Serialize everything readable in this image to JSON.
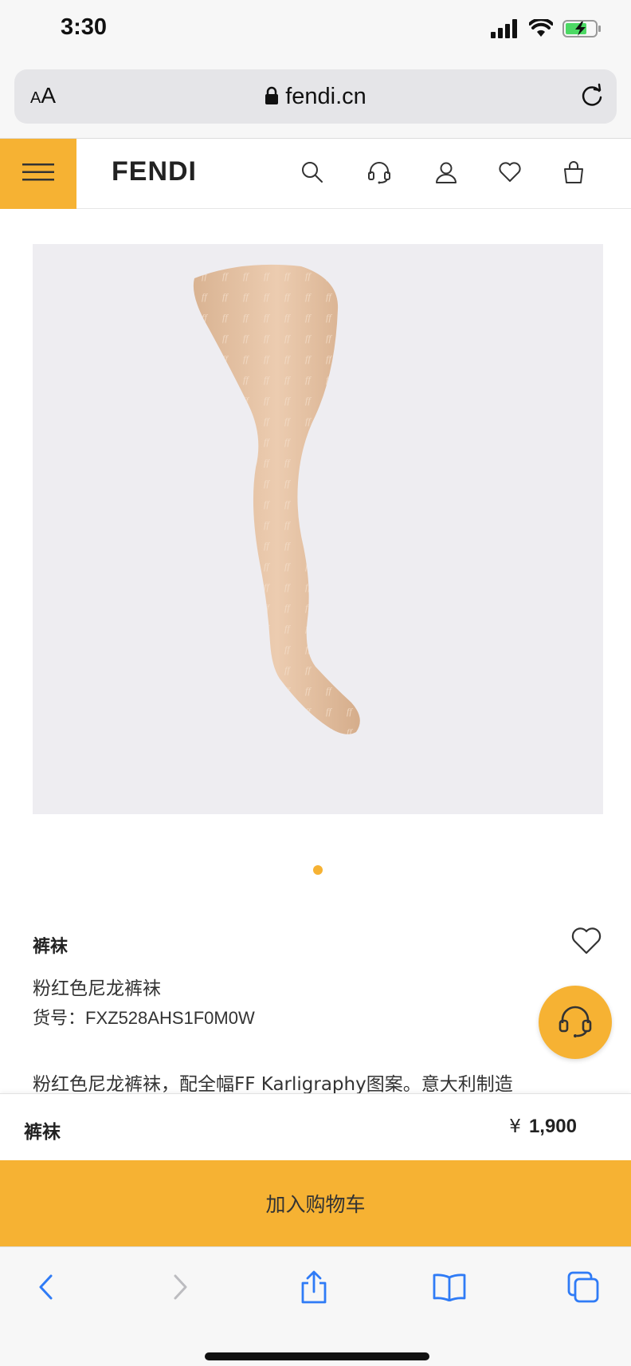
{
  "status_bar": {
    "time": "3:30"
  },
  "browser": {
    "text_size_label_small": "A",
    "text_size_label_large": "A",
    "url": "fendi.cn"
  },
  "header": {
    "logo": "FENDI",
    "icons": [
      "menu-icon",
      "search-icon",
      "customer-service-icon",
      "account-icon",
      "wishlist-icon",
      "shopping-bag-icon"
    ]
  },
  "carousel": {
    "current_slide": 1,
    "total_slides": 1
  },
  "product": {
    "category": "裤袜",
    "subtitle": "粉红色尼龙裤袜",
    "sku_label": "货号：",
    "sku": "FXZ528AHS1F0M0W",
    "description": "粉红色尼龙裤袜，配全幅FF Karligraphy图案。意大利制造"
  },
  "buy_bar": {
    "name": "裤袜",
    "currency": "¥",
    "price": "1,900",
    "add_to_cart_label": "加入购物车"
  },
  "colors": {
    "accent": "#f6b233",
    "image_bg": "#eeedf1",
    "skin": "#e6c4a6"
  },
  "toolbar": {
    "icons": [
      "back-icon",
      "forward-icon",
      "share-icon",
      "bookmarks-icon",
      "tabs-icon"
    ]
  }
}
